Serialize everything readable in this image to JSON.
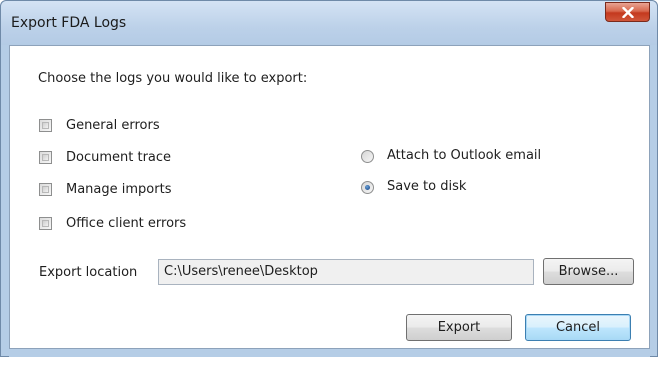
{
  "window": {
    "title": "Export FDA Logs"
  },
  "prompt": "Choose the logs you would like to export:",
  "log_options": [
    {
      "label": "General errors",
      "checked": false
    },
    {
      "label": "Document trace",
      "checked": false
    },
    {
      "label": "Manage imports",
      "checked": false
    },
    {
      "label": "Office client errors",
      "checked": false
    }
  ],
  "destination_options": [
    {
      "label": "Attach to Outlook email",
      "selected": false
    },
    {
      "label": "Save to disk",
      "selected": true
    }
  ],
  "export_location": {
    "label": "Export location",
    "value": "C:\\Users\\renee\\Desktop",
    "browse_label": "Browse..."
  },
  "buttons": {
    "export": "Export",
    "cancel": "Cancel"
  },
  "icons": {
    "close": "close-icon"
  },
  "colors": {
    "title_bar": "#bcd1e9",
    "close_button": "#c4391e",
    "default_button_border": "#3c7fb1"
  }
}
